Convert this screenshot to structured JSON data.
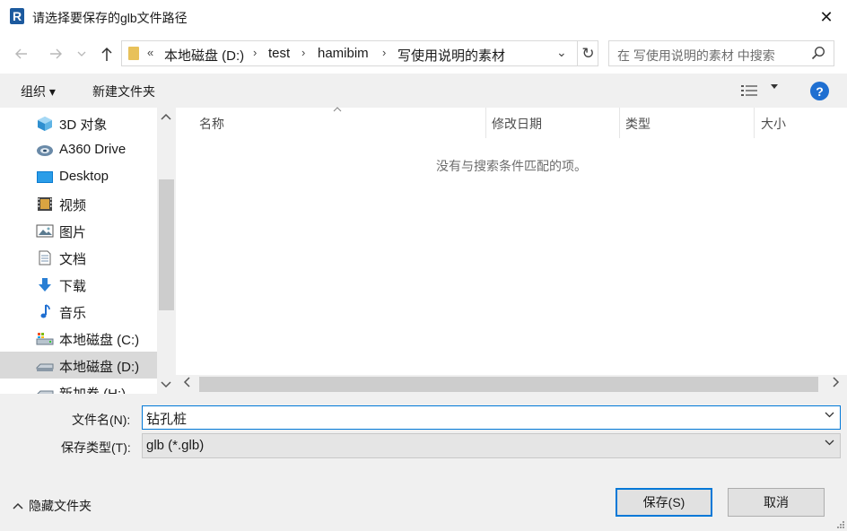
{
  "window": {
    "title": "请选择要保存的glb文件路径",
    "close_glyph": "✕"
  },
  "address": {
    "overflow_chevron": "«",
    "breadcrumbs": [
      "本地磁盘 (D:)",
      "test",
      "hamibim",
      "写使用说明的素材"
    ],
    "separator": "›",
    "dropdown_glyph": "⌄",
    "refresh_glyph": "↻"
  },
  "search": {
    "placeholder": "在 写使用说明的素材 中搜索"
  },
  "toolbar": {
    "organize": "组织 ▾",
    "new_folder": "新建文件夹"
  },
  "sidebar": {
    "items": [
      {
        "label": "3D 对象",
        "icon": "3d-objects-icon",
        "selected": false
      },
      {
        "label": "A360 Drive",
        "icon": "a360-drive-icon",
        "selected": false
      },
      {
        "label": "Desktop",
        "icon": "desktop-icon",
        "selected": false
      },
      {
        "label": "视频",
        "icon": "video-icon",
        "selected": false
      },
      {
        "label": "图片",
        "icon": "pictures-icon",
        "selected": false
      },
      {
        "label": "文档",
        "icon": "documents-icon",
        "selected": false
      },
      {
        "label": "下载",
        "icon": "downloads-icon",
        "selected": false
      },
      {
        "label": "音乐",
        "icon": "music-icon",
        "selected": false
      },
      {
        "label": "本地磁盘 (C:)",
        "icon": "drive-c-icon",
        "selected": false
      },
      {
        "label": "本地磁盘 (D:)",
        "icon": "drive-d-icon",
        "selected": true
      },
      {
        "label": "新加卷 (H:)",
        "icon": "drive-h-icon",
        "selected": false
      }
    ]
  },
  "files": {
    "columns": [
      "名称",
      "修改日期",
      "类型",
      "大小"
    ],
    "empty_message": "没有与搜索条件匹配的项。"
  },
  "form": {
    "filename_label": "文件名(N):",
    "filename_value": "钻孔桩",
    "filetype_label": "保存类型(T):",
    "filetype_value": "glb (*.glb)"
  },
  "footer": {
    "hide_folders": "隐藏文件夹",
    "save": "保存(S)",
    "cancel": "取消"
  },
  "colors": {
    "accent": "#0078d7",
    "help": "#1f6fd1",
    "folder": "#e8c15a"
  }
}
